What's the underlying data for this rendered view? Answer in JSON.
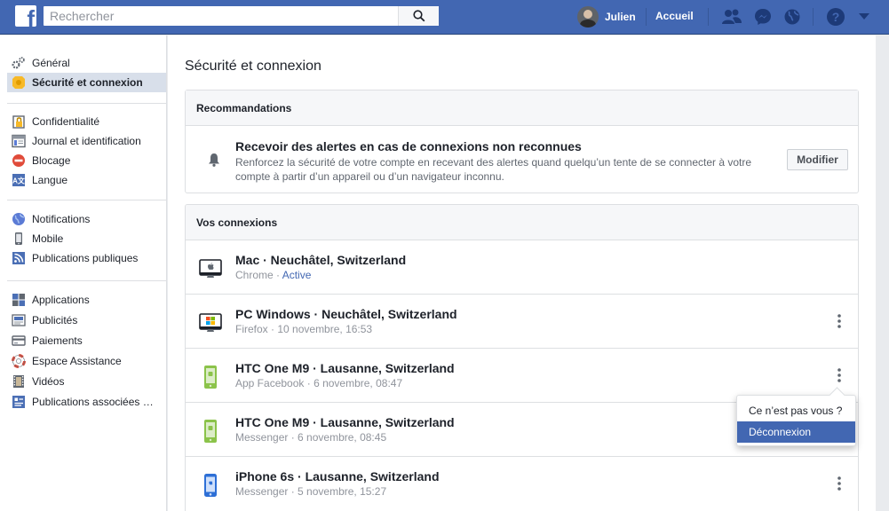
{
  "topbar": {
    "search_placeholder": "Rechercher",
    "profile_name": "Julien",
    "home_label": "Accueil"
  },
  "sidebar": {
    "group1": [
      {
        "label": "Général",
        "icon": "gears-icon"
      },
      {
        "label": "Sécurité et connexion",
        "icon": "badge-icon",
        "active": true
      }
    ],
    "group2": [
      {
        "label": "Confidentialité",
        "icon": "lock-icon"
      },
      {
        "label": "Journal et identification",
        "icon": "timeline-icon"
      },
      {
        "label": "Blocage",
        "icon": "block-icon"
      },
      {
        "label": "Langue",
        "icon": "language-icon"
      }
    ],
    "group3": [
      {
        "label": "Notifications",
        "icon": "globe-icon"
      },
      {
        "label": "Mobile",
        "icon": "mobile-icon"
      },
      {
        "label": "Publications publiques",
        "icon": "rss-icon"
      }
    ],
    "group4": [
      {
        "label": "Applications",
        "icon": "apps-icon"
      },
      {
        "label": "Publicités",
        "icon": "ads-icon"
      },
      {
        "label": "Paiements",
        "icon": "card-icon"
      },
      {
        "label": "Espace Assistance",
        "icon": "lifebuoy-icon"
      },
      {
        "label": "Vidéos",
        "icon": "film-icon"
      },
      {
        "label": "Publications associées …",
        "icon": "linked-posts-icon"
      }
    ]
  },
  "main": {
    "title": "Sécurité et connexion",
    "recommendations": {
      "header": "Recommandations",
      "title": "Recevoir des alertes en cas de connexions non reconnues",
      "description": "Renforcez la sécurité de votre compte en recevant des alertes quand quelqu’un tente de se connecter à votre compte à partir d’un appareil ou d’un navigateur inconnu.",
      "button": "Modifier"
    },
    "connections": {
      "header": "Vos connexions",
      "items": [
        {
          "title": "Mac · Neuchâtel, Switzerland",
          "app": "Chrome",
          "status": "Active",
          "device": "mac"
        },
        {
          "title": "PC Windows · Neuchâtel, Switzerland",
          "app": "Firefox",
          "time": "10 novembre, 16:53",
          "device": "windows"
        },
        {
          "title": "HTC One M9 · Lausanne, Switzerland",
          "app": "App Facebook",
          "time": "6 novembre, 08:47",
          "device": "android"
        },
        {
          "title": "HTC One M9 · Lausanne, Switzerland",
          "app": "Messenger",
          "time": "6 novembre, 08:45",
          "device": "android"
        },
        {
          "title": "iPhone 6s · Lausanne, Switzerland",
          "app": "Messenger",
          "time": "5 novembre, 15:27",
          "device": "iphone"
        }
      ],
      "separator": " · "
    }
  },
  "menu": {
    "items": [
      "Ce n’est pas vous ?",
      "Déconnexion"
    ]
  },
  "colors": {
    "brand": "#4267b2",
    "link": "#4267b2",
    "android": "#8bc34a",
    "iphone": "#2d6fd6"
  }
}
